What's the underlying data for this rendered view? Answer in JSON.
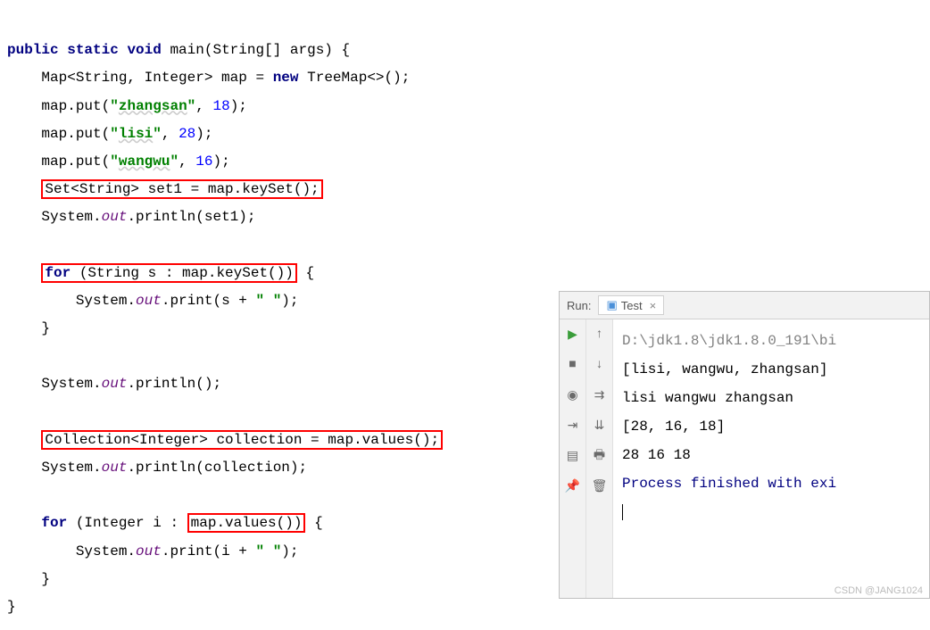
{
  "code": {
    "kw_public": "public",
    "kw_static": "static",
    "kw_void": "void",
    "kw_new": "new",
    "kw_for": "for",
    "fn_main": "main",
    "type_string_arr": "String[]",
    "param_args": "args",
    "type_map": "Map<String, Integer>",
    "var_map": "map",
    "eq": "=",
    "type_treemap": "TreeMap<>",
    "empty_parens_semi": "();",
    "put": "put",
    "str_zhangsan": "\"zhangsan\"",
    "str_lisi": "\"lisi\"",
    "str_wangwu": "\"wangwu\"",
    "num_18": "18",
    "num_28": "28",
    "num_16": "16",
    "boxed_set_decl": "Set<String> set1 = map.keySet();",
    "sys": "System",
    "out": "out",
    "println": "println",
    "print": "print",
    "arg_set1": "set1",
    "boxed_for_header": "for (String s : map.keySet())",
    "print_s_expr": "s + \" \"",
    "println_empty": "()",
    "boxed_collection_decl": "Collection<Integer> collection = map.values();",
    "arg_collection": "collection",
    "for_int_left": "for (Integer i : ",
    "boxed_map_values": "map.values())",
    "print_i_expr": "i + \" \""
  },
  "run": {
    "panel_label": "Run:",
    "tab_name": "Test",
    "close": "×",
    "lines": {
      "path": "D:\\jdk1.8\\jdk1.8.0_191\\bi",
      "out1": "[lisi, wangwu, zhangsan]",
      "out2": "lisi wangwu zhangsan ",
      "out3": "[28, 16, 18]",
      "out4": "28 16 18 ",
      "out5": "Process finished with exi"
    }
  },
  "watermark": "CSDN @JANG1024"
}
